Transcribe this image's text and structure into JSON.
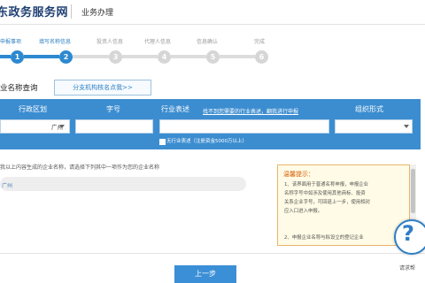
{
  "header": {
    "site_title": "东政务服务网",
    "section_title": "业务办理"
  },
  "steps": [
    {
      "label": "申报事项",
      "number": "1",
      "active": true
    },
    {
      "label": "填写名称信息",
      "number": "2",
      "active": true
    },
    {
      "label": "投资人信息",
      "number": "3",
      "active": false
    },
    {
      "label": "代理人信息",
      "number": "4",
      "active": false
    },
    {
      "label": "信息确认",
      "number": "5",
      "active": false
    },
    {
      "label": "完成",
      "number": "6",
      "active": false
    }
  ],
  "query": {
    "title": "业名称查询",
    "branch_link": "分支机构核名点我>>",
    "col_region": "行政区划",
    "col_zihao": "字号",
    "col_industry": "行业表述",
    "col_industry_hint": "找不到您需要的行业表述，翻我进行申报",
    "col_org": "组织形式",
    "region_value": "广州",
    "checkbox_label": "无行业表述（注册资金5000万以上）"
  },
  "result": {
    "text": "我以上内容生成的企业名称，请选择下列其中一项作为您的企业名称",
    "name": "广州"
  },
  "tips": {
    "title": "温馨提示：",
    "line1a": "1、该界面用于普通名称申报，申报企业",
    "line1b": "名称字号中如涉及使用其他商标、投资",
    "line1c": "关系企业字号，可回退上一步，使用相对",
    "line1d": "应入口进入申报。",
    "line2": "2、申报企业名称与拟设立的登记企业"
  },
  "footer": {
    "prev_label": "上一步"
  },
  "help": {
    "label": "请求帮"
  },
  "colors": {
    "accent": "#2d89d0",
    "panel": "#3c8dd0",
    "warning": "#d55e00"
  }
}
